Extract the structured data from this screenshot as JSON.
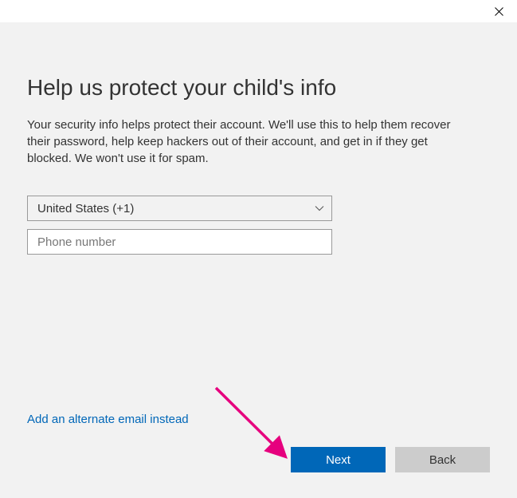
{
  "heading": "Help us protect your child's info",
  "description": "Your security info helps protect their account. We'll use this to help them recover their password, help keep hackers out of their account, and get in if they get blocked. We won't use it for spam.",
  "country_select": {
    "selected": "United States (+1)"
  },
  "phone_input": {
    "placeholder": "Phone number",
    "value": ""
  },
  "alt_link": "Add an alternate email instead",
  "buttons": {
    "next": "Next",
    "back": "Back"
  },
  "colors": {
    "primary": "#0067b8",
    "annotation": "#e6007e"
  }
}
